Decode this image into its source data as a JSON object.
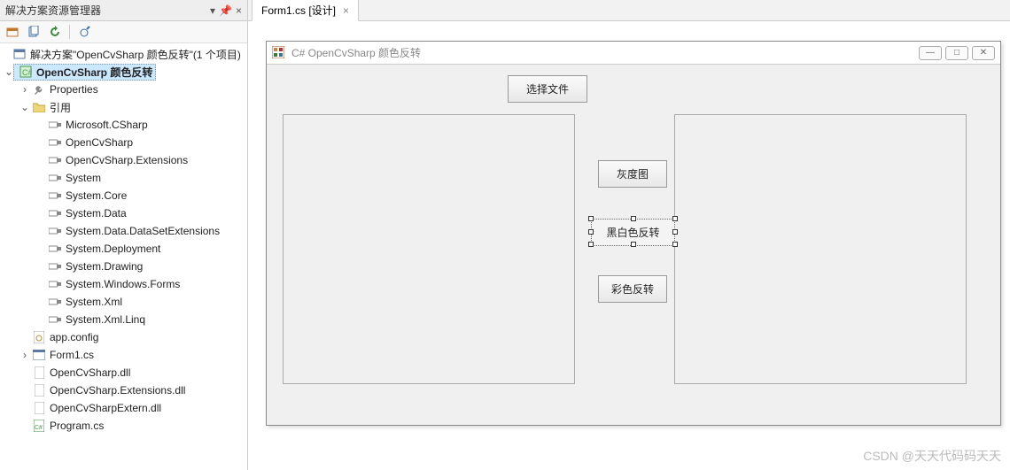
{
  "panel": {
    "title": "解决方案资源管理器",
    "root_label": "解决方案\"OpenCvSharp 颜色反转\"(1 个项目)",
    "project": "OpenCvSharp 颜色反转",
    "nodes": {
      "properties": "Properties",
      "references": "引用",
      "ref_items": [
        "Microsoft.CSharp",
        "OpenCvSharp",
        "OpenCvSharp.Extensions",
        "System",
        "System.Core",
        "System.Data",
        "System.Data.DataSetExtensions",
        "System.Deployment",
        "System.Drawing",
        "System.Windows.Forms",
        "System.Xml",
        "System.Xml.Linq"
      ],
      "appconfig": "app.config",
      "form1": "Form1.cs",
      "dll1": "OpenCvSharp.dll",
      "dll2": "OpenCvSharp.Extensions.dll",
      "dll3": "OpenCvSharpExtern.dll",
      "program": "Program.cs"
    }
  },
  "tab": {
    "label": "Form1.cs [设计]"
  },
  "form": {
    "title": "C# OpenCvSharp 颜色反转",
    "buttons": {
      "select_file": "选择文件",
      "grayscale": "灰度图",
      "bw_invert": "黑白色反转",
      "color_invert": "彩色反转"
    }
  },
  "watermark": "CSDN @天天代码码天天"
}
